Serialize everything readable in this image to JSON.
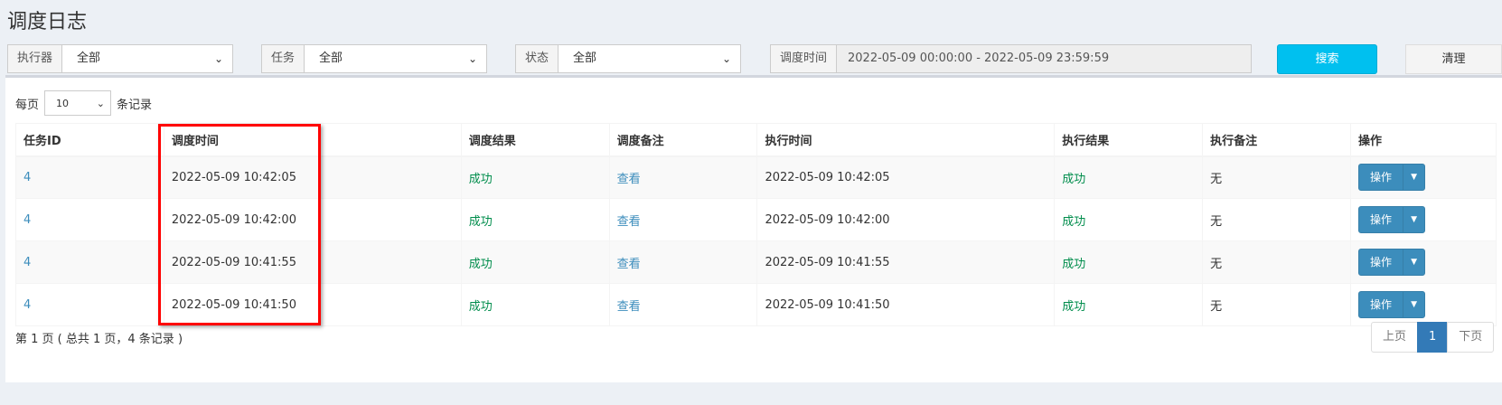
{
  "page": {
    "title": "调度日志"
  },
  "filters": {
    "executor": {
      "label": "执行器",
      "value": "全部"
    },
    "task": {
      "label": "任务",
      "value": "全部"
    },
    "status": {
      "label": "状态",
      "value": "全部"
    },
    "time": {
      "label": "调度时间",
      "value": "2022-05-09 00:00:00 - 2022-05-09 23:59:59"
    }
  },
  "buttons": {
    "search": "搜索",
    "clear": "清理"
  },
  "length": {
    "prefix": "每页",
    "value": "10",
    "suffix": "条记录"
  },
  "table": {
    "headers": [
      "任务ID",
      "调度时间",
      "调度结果",
      "调度备注",
      "执行时间",
      "执行结果",
      "执行备注",
      "操作"
    ],
    "rows": [
      {
        "id": "4",
        "trigger_time": "2022-05-09 10:42:05",
        "trigger_result": "成功",
        "trigger_note": "查看",
        "exec_time": "2022-05-09 10:42:05",
        "exec_result": "成功",
        "exec_note": "无",
        "action": "操作"
      },
      {
        "id": "4",
        "trigger_time": "2022-05-09 10:42:00",
        "trigger_result": "成功",
        "trigger_note": "查看",
        "exec_time": "2022-05-09 10:42:00",
        "exec_result": "成功",
        "exec_note": "无",
        "action": "操作"
      },
      {
        "id": "4",
        "trigger_time": "2022-05-09 10:41:55",
        "trigger_result": "成功",
        "trigger_note": "查看",
        "exec_time": "2022-05-09 10:41:55",
        "exec_result": "成功",
        "exec_note": "无",
        "action": "操作"
      },
      {
        "id": "4",
        "trigger_time": "2022-05-09 10:41:50",
        "trigger_result": "成功",
        "trigger_note": "查看",
        "exec_time": "2022-05-09 10:41:50",
        "exec_result": "成功",
        "exec_note": "无",
        "action": "操作"
      }
    ]
  },
  "info": "第 1 页 ( 总共 1 页，4 条记录 )",
  "pager": {
    "prev": "上页",
    "current": "1",
    "next": "下页"
  },
  "colors": {
    "accent": "#00c0ef",
    "primary": "#3c8dbc",
    "success": "#008d4c",
    "highlight": "#ff0000"
  }
}
